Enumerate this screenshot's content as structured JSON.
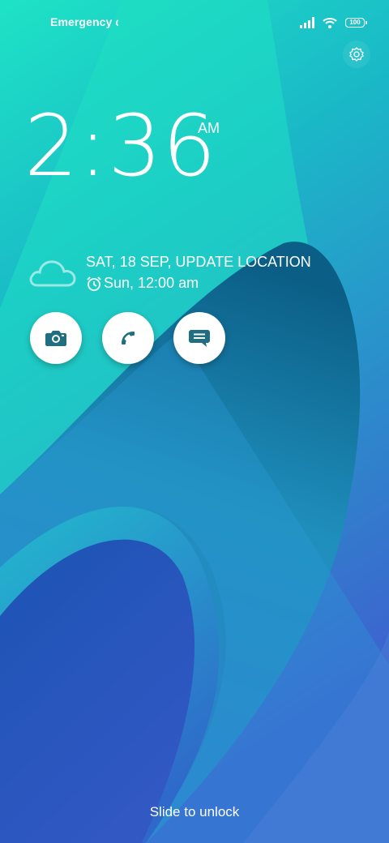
{
  "status_bar": {
    "carrier": "Emergency c",
    "battery_level": "100",
    "icons": [
      "signal-icon",
      "wifi-icon",
      "battery-icon"
    ]
  },
  "settings": {
    "icon": "gear-icon"
  },
  "clock": {
    "time": "2:36",
    "ampm": "AM"
  },
  "info": {
    "date_line": "SAT, 18 SEP, UPDATE LOCATION",
    "alarm_line": "Sun, 12:00 am",
    "weather_icon": "cloud-icon",
    "alarm_icon": "alarm-clock-icon"
  },
  "shortcuts": [
    {
      "icon": "camera-icon"
    },
    {
      "icon": "phone-icon"
    },
    {
      "icon": "message-icon"
    }
  ],
  "footer": {
    "unlock_hint": "Slide to unlock"
  },
  "colors": {
    "wallpaper_top": "#17dcc4",
    "wallpaper_bottom": "#3b5fcf",
    "shortcut_icon": "#1f6e82",
    "shortcut_bg": "#ffffff"
  }
}
